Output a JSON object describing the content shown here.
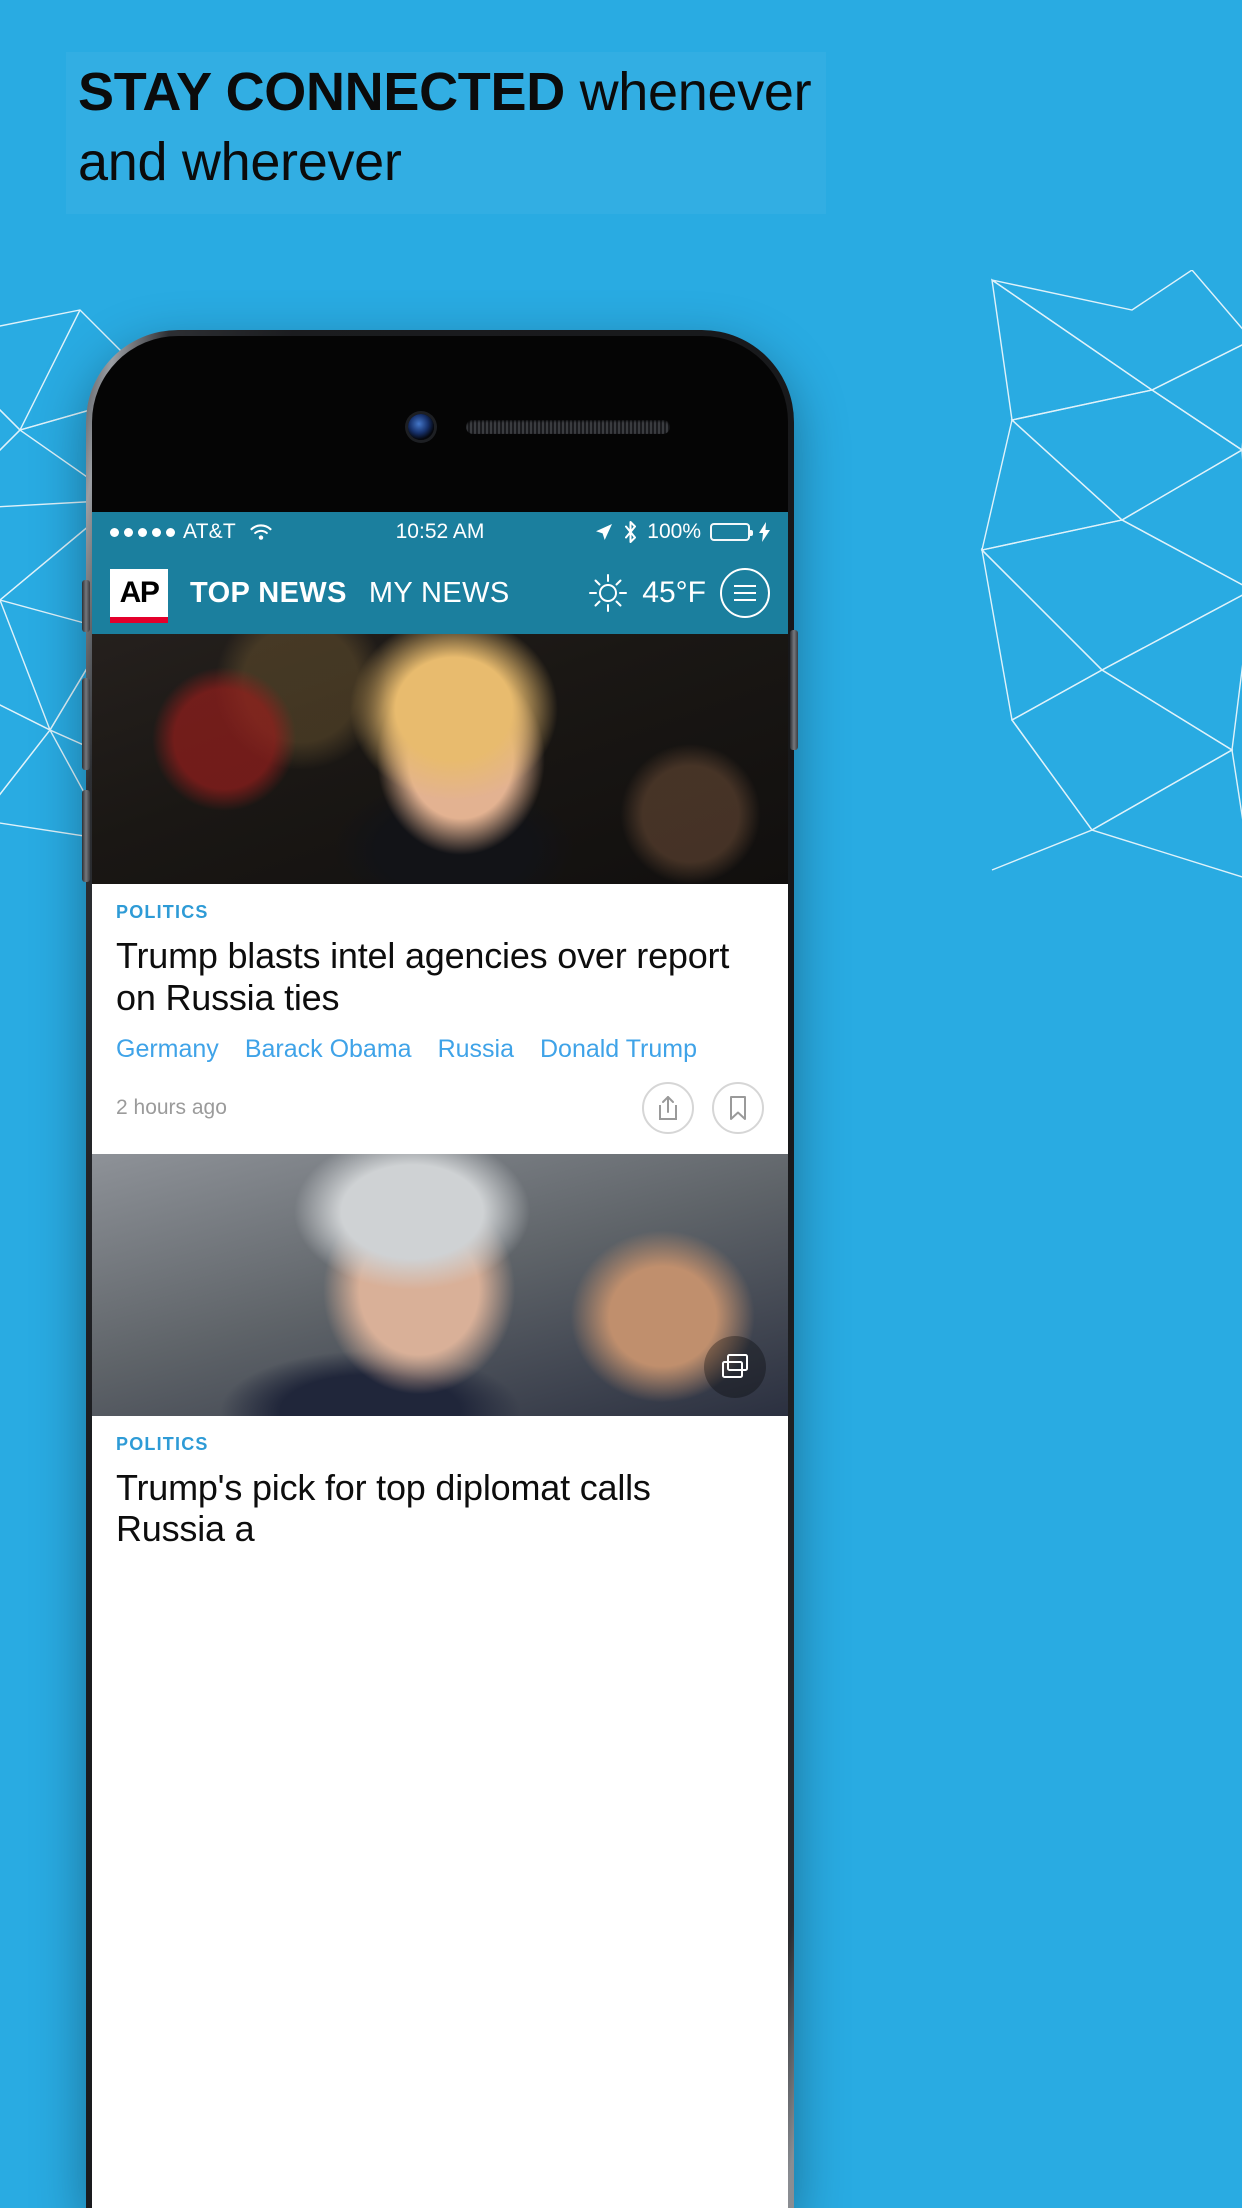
{
  "promo": {
    "headline_strong": "STAY CONNECTED",
    "headline_light": " whenever and wherever",
    "background_color": "#29ABE2"
  },
  "device": {
    "type": "iphone",
    "camera_icon": "front-camera",
    "speaker_icon": "earpiece-speaker"
  },
  "screen": {
    "statusbar": {
      "signal_dots": 5,
      "carrier": "AT&T",
      "wifi_icon": "wifi-icon",
      "time": "10:52 AM",
      "location_icon": "location-arrow-icon",
      "bluetooth_icon": "bluetooth-icon",
      "battery_percent": "100%",
      "battery_color": "#57d964",
      "charging_icon": "lightning-bolt-icon",
      "background_color": "#1b7f9e"
    },
    "navbar": {
      "logo_text": "AP",
      "logo_accent_color": "#E4002B",
      "tabs": [
        {
          "label": "TOP NEWS",
          "active": true
        },
        {
          "label": "MY NEWS",
          "active": false
        }
      ],
      "weather_icon": "sun-icon",
      "temperature": "45°F",
      "menu_icon": "hamburger-menu-icon"
    },
    "articles": [
      {
        "photo": "donald-trump-portrait",
        "kicker": "POLITICS",
        "headline": "Trump blasts intel agencies over report on Russia ties",
        "tags": [
          "Germany",
          "Barack Obama",
          "Russia",
          "Donald Trump"
        ],
        "timestamp": "2 hours ago",
        "share_icon": "share-icon",
        "bookmark_icon": "bookmark-icon"
      },
      {
        "photo": "rex-tillerson-portrait",
        "kicker": "POLITICS",
        "headline": "Trump's pick for top diplomat calls Russia a",
        "gallery_icon": "gallery-stack-icon"
      }
    ],
    "accent_colors": {
      "kicker": "#2E9BD6",
      "tag_link": "#3FA3E8",
      "chrome": "#1b7f9e"
    }
  }
}
